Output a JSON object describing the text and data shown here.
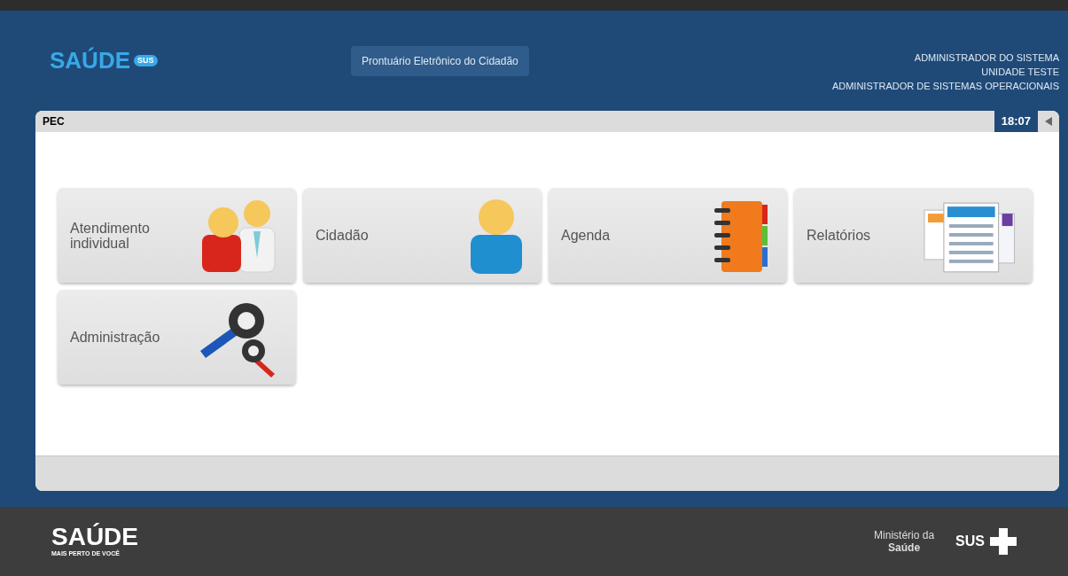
{
  "header": {
    "logo": "SAÚDE",
    "logo_badge": "SUS",
    "system_title": "Prontuário Eletrônico do Cidadão",
    "user": {
      "name": "ADMINISTRADOR DO SISTEMA",
      "unit": "UNIDADE TESTE",
      "role": "ADMINISTRADOR DE SISTEMAS OPERACIONAIS"
    }
  },
  "panel": {
    "title": "PEC",
    "clock": "18:07"
  },
  "modules": [
    {
      "label": "Atendimento individual",
      "kind": "attendance"
    },
    {
      "label": "Cidadão",
      "kind": "citizen"
    },
    {
      "label": "Agenda",
      "kind": "agenda"
    },
    {
      "label": "Relatórios",
      "kind": "reports"
    },
    {
      "label": "Administração",
      "kind": "admin"
    }
  ],
  "footer": {
    "logo": "SAÚDE",
    "slogan": "MAIS PERTO DE VOCÊ",
    "ministry_line1": "Ministério da",
    "ministry_line2": "Saúde",
    "sus": "SUS"
  }
}
